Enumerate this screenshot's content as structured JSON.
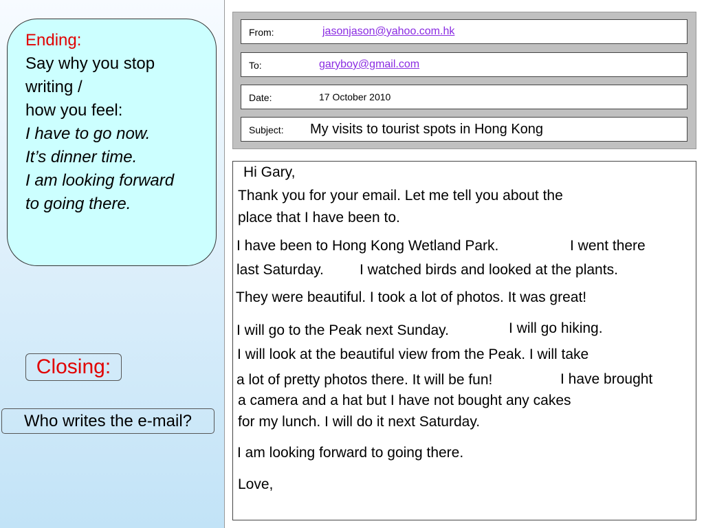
{
  "ending": {
    "heading": "Ending:",
    "line1": "Say why you stop",
    "line2": "writing /",
    "line3": "how you feel:",
    "example1": "I have to go now.",
    "example2": "It’s dinner time.",
    "example3": "I am looking forward",
    "example4": "to going there."
  },
  "closing_label": "Closing:",
  "question": "Who writes the e-mail?",
  "email_header": {
    "from_label": "From:",
    "from_value": "jasonjason@yahoo.com.hk",
    "to_label": "To:",
    "to_value": "garyboy@gmail.com",
    "date_label": "Date:",
    "date_value": "17 October 2010",
    "subject_label": "Subject:",
    "subject_value": "My visits to tourist spots in Hong Kong"
  },
  "email_body": {
    "greeting": "Hi Gary,",
    "l1": "Thank you for your email. Let me tell you about the",
    "l2": "place that I have been to.",
    "l3a": "I have been to Hong Kong Wetland Park.",
    "l3b": "I went there",
    "l4a": "last Saturday.",
    "l4b": "I watched birds and looked at the plants.",
    "l5": "They were beautiful. I took a lot of photos. It was great!",
    "l6a": "I will go to the Peak next Sunday.",
    "l6b": "I will go hiking.",
    "l7": "I will look at the beautiful view from the Peak. I will take",
    "l8a": "a lot of pretty photos there. It will be fun!",
    "l8b": "I have brought",
    "l9": "a camera and a hat but I have not bought any cakes",
    "l10": "for my lunch. I will do it next Saturday.",
    "l11": "I am looking forward to going there.",
    "signoff": "Love,"
  }
}
